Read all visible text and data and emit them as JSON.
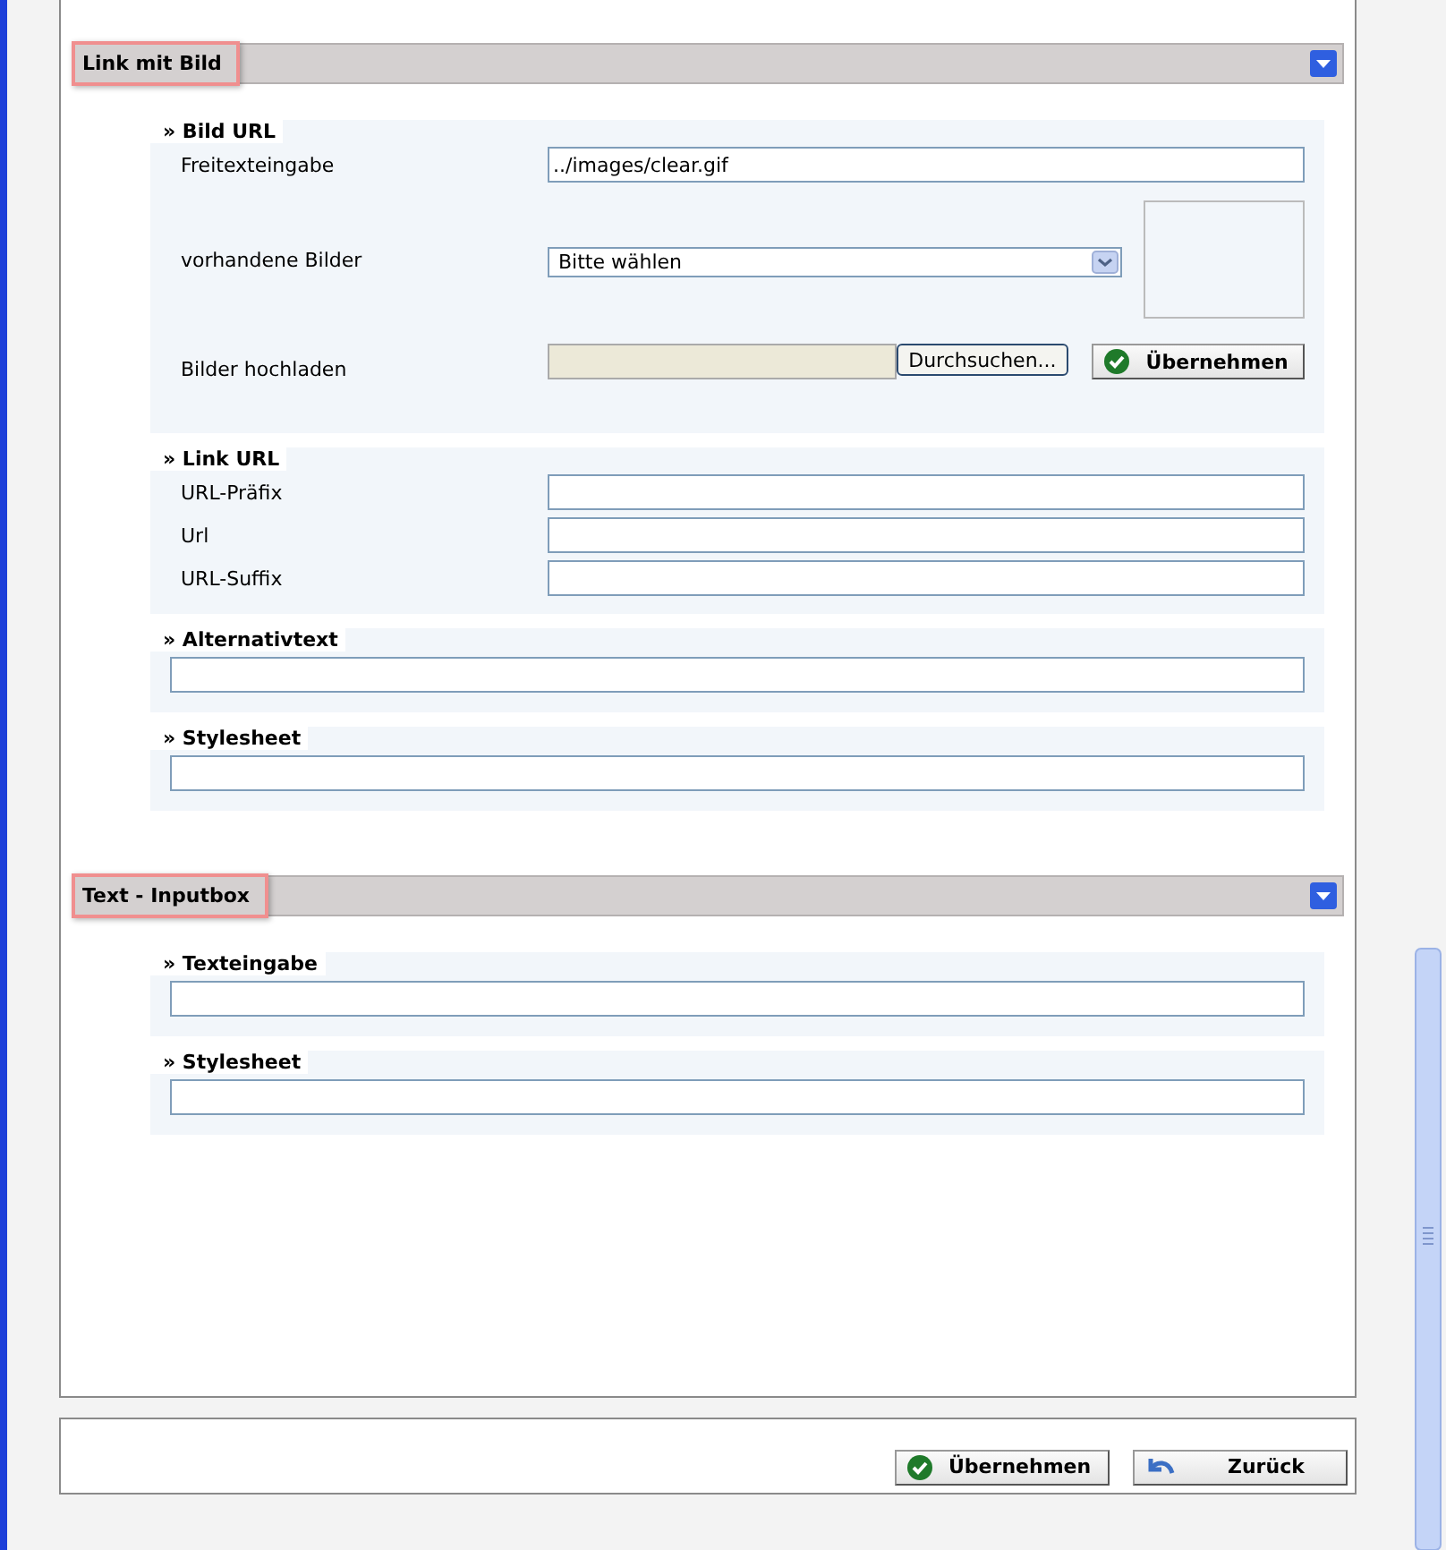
{
  "sections": [
    {
      "title": "Link mit Bild",
      "expanded": true,
      "groups": [
        {
          "title": "» Bild URL",
          "fields": [
            {
              "kind": "text",
              "label": "Freitexteingabe",
              "value": "../images/clear.gif"
            },
            {
              "kind": "select",
              "label": "vorhandene Bilder",
              "value": "Bitte wählen"
            },
            {
              "kind": "upload",
              "label": "Bilder hochladen",
              "browse": "Durchsuchen...",
              "apply": "Übernehmen"
            }
          ]
        },
        {
          "title": "» Link URL",
          "fields": [
            {
              "kind": "text",
              "label": "URL-Präfix"
            },
            {
              "kind": "text",
              "label": "Url"
            },
            {
              "kind": "text",
              "label": "URL-Suffix"
            }
          ]
        },
        {
          "title": "» Alternativtext",
          "fields": [
            {
              "kind": "full"
            }
          ]
        },
        {
          "title": "» Stylesheet",
          "fields": [
            {
              "kind": "full"
            }
          ]
        }
      ]
    },
    {
      "title": "Text - Inputbox",
      "expanded": true,
      "groups": [
        {
          "title": "» Texteingabe",
          "fields": [
            {
              "kind": "full"
            }
          ]
        },
        {
          "title": "» Stylesheet",
          "fields": [
            {
              "kind": "full"
            }
          ]
        }
      ]
    }
  ],
  "footer": {
    "buttons": [
      {
        "kind": "apply",
        "label": "Übernehmen"
      },
      {
        "kind": "back",
        "label": "Zurück"
      }
    ]
  }
}
